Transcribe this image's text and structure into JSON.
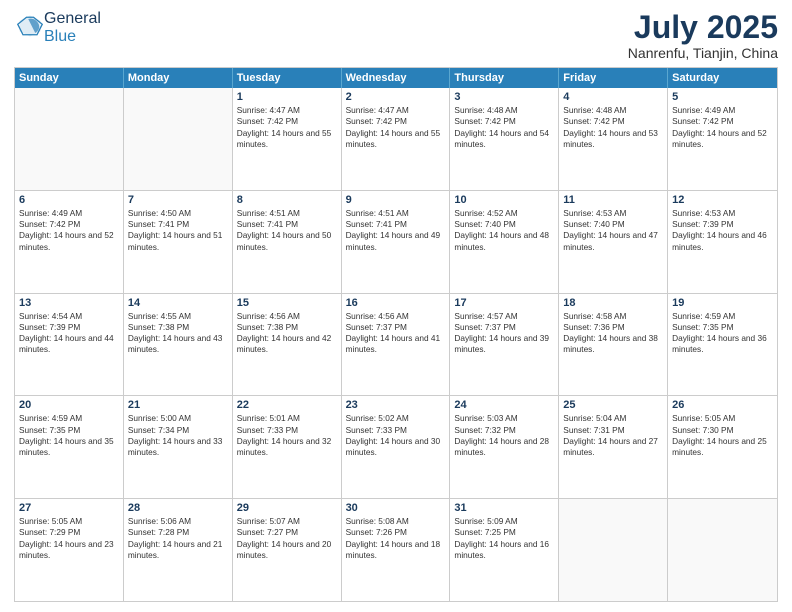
{
  "header": {
    "logo_general": "General",
    "logo_blue": "Blue",
    "month_year": "July 2025",
    "location": "Nanrenfu, Tianjin, China"
  },
  "weekdays": [
    "Sunday",
    "Monday",
    "Tuesday",
    "Wednesday",
    "Thursday",
    "Friday",
    "Saturday"
  ],
  "weeks": [
    [
      {
        "day": "",
        "empty": true
      },
      {
        "day": "",
        "empty": true
      },
      {
        "day": "1",
        "sunrise": "4:47 AM",
        "sunset": "7:42 PM",
        "daylight": "14 hours and 55 minutes."
      },
      {
        "day": "2",
        "sunrise": "4:47 AM",
        "sunset": "7:42 PM",
        "daylight": "14 hours and 55 minutes."
      },
      {
        "day": "3",
        "sunrise": "4:48 AM",
        "sunset": "7:42 PM",
        "daylight": "14 hours and 54 minutes."
      },
      {
        "day": "4",
        "sunrise": "4:48 AM",
        "sunset": "7:42 PM",
        "daylight": "14 hours and 53 minutes."
      },
      {
        "day": "5",
        "sunrise": "4:49 AM",
        "sunset": "7:42 PM",
        "daylight": "14 hours and 52 minutes."
      }
    ],
    [
      {
        "day": "6",
        "sunrise": "4:49 AM",
        "sunset": "7:42 PM",
        "daylight": "14 hours and 52 minutes."
      },
      {
        "day": "7",
        "sunrise": "4:50 AM",
        "sunset": "7:41 PM",
        "daylight": "14 hours and 51 minutes."
      },
      {
        "day": "8",
        "sunrise": "4:51 AM",
        "sunset": "7:41 PM",
        "daylight": "14 hours and 50 minutes."
      },
      {
        "day": "9",
        "sunrise": "4:51 AM",
        "sunset": "7:41 PM",
        "daylight": "14 hours and 49 minutes."
      },
      {
        "day": "10",
        "sunrise": "4:52 AM",
        "sunset": "7:40 PM",
        "daylight": "14 hours and 48 minutes."
      },
      {
        "day": "11",
        "sunrise": "4:53 AM",
        "sunset": "7:40 PM",
        "daylight": "14 hours and 47 minutes."
      },
      {
        "day": "12",
        "sunrise": "4:53 AM",
        "sunset": "7:39 PM",
        "daylight": "14 hours and 46 minutes."
      }
    ],
    [
      {
        "day": "13",
        "sunrise": "4:54 AM",
        "sunset": "7:39 PM",
        "daylight": "14 hours and 44 minutes."
      },
      {
        "day": "14",
        "sunrise": "4:55 AM",
        "sunset": "7:38 PM",
        "daylight": "14 hours and 43 minutes."
      },
      {
        "day": "15",
        "sunrise": "4:56 AM",
        "sunset": "7:38 PM",
        "daylight": "14 hours and 42 minutes."
      },
      {
        "day": "16",
        "sunrise": "4:56 AM",
        "sunset": "7:37 PM",
        "daylight": "14 hours and 41 minutes."
      },
      {
        "day": "17",
        "sunrise": "4:57 AM",
        "sunset": "7:37 PM",
        "daylight": "14 hours and 39 minutes."
      },
      {
        "day": "18",
        "sunrise": "4:58 AM",
        "sunset": "7:36 PM",
        "daylight": "14 hours and 38 minutes."
      },
      {
        "day": "19",
        "sunrise": "4:59 AM",
        "sunset": "7:35 PM",
        "daylight": "14 hours and 36 minutes."
      }
    ],
    [
      {
        "day": "20",
        "sunrise": "4:59 AM",
        "sunset": "7:35 PM",
        "daylight": "14 hours and 35 minutes."
      },
      {
        "day": "21",
        "sunrise": "5:00 AM",
        "sunset": "7:34 PM",
        "daylight": "14 hours and 33 minutes."
      },
      {
        "day": "22",
        "sunrise": "5:01 AM",
        "sunset": "7:33 PM",
        "daylight": "14 hours and 32 minutes."
      },
      {
        "day": "23",
        "sunrise": "5:02 AM",
        "sunset": "7:33 PM",
        "daylight": "14 hours and 30 minutes."
      },
      {
        "day": "24",
        "sunrise": "5:03 AM",
        "sunset": "7:32 PM",
        "daylight": "14 hours and 28 minutes."
      },
      {
        "day": "25",
        "sunrise": "5:04 AM",
        "sunset": "7:31 PM",
        "daylight": "14 hours and 27 minutes."
      },
      {
        "day": "26",
        "sunrise": "5:05 AM",
        "sunset": "7:30 PM",
        "daylight": "14 hours and 25 minutes."
      }
    ],
    [
      {
        "day": "27",
        "sunrise": "5:05 AM",
        "sunset": "7:29 PM",
        "daylight": "14 hours and 23 minutes."
      },
      {
        "day": "28",
        "sunrise": "5:06 AM",
        "sunset": "7:28 PM",
        "daylight": "14 hours and 21 minutes."
      },
      {
        "day": "29",
        "sunrise": "5:07 AM",
        "sunset": "7:27 PM",
        "daylight": "14 hours and 20 minutes."
      },
      {
        "day": "30",
        "sunrise": "5:08 AM",
        "sunset": "7:26 PM",
        "daylight": "14 hours and 18 minutes."
      },
      {
        "day": "31",
        "sunrise": "5:09 AM",
        "sunset": "7:25 PM",
        "daylight": "14 hours and 16 minutes."
      },
      {
        "day": "",
        "empty": true
      },
      {
        "day": "",
        "empty": true
      }
    ]
  ],
  "labels": {
    "sunrise": "Sunrise:",
    "sunset": "Sunset:",
    "daylight": "Daylight:"
  }
}
